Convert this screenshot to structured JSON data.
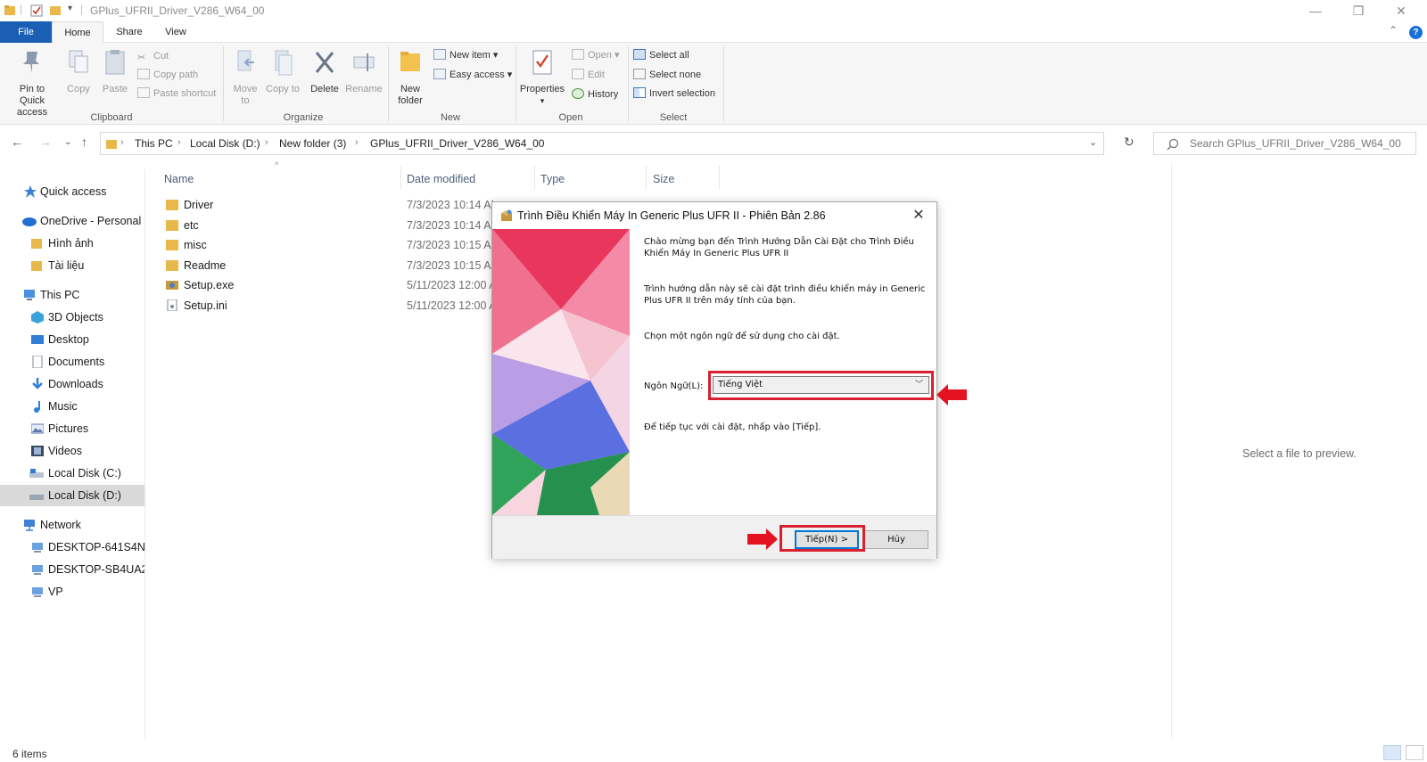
{
  "window": {
    "title": "GPlus_UFRII_Driver_V286_W64_00",
    "controls": {
      "minimize": "—",
      "maximize": "❐",
      "close": "✕"
    }
  },
  "tabs": [
    "File",
    "Home",
    "Share",
    "View"
  ],
  "ribbon": {
    "clipboard": {
      "label": "Clipboard",
      "pin": "Pin to Quick access",
      "copy": "Copy",
      "paste": "Paste",
      "cut": "Cut",
      "copy_path": "Copy path",
      "paste_shortcut": "Paste shortcut"
    },
    "organize": {
      "label": "Organize",
      "move_to": "Move to",
      "copy_to": "Copy to",
      "delete": "Delete",
      "rename": "Rename"
    },
    "new": {
      "label": "New",
      "new_folder": "New folder",
      "new_item": "New item",
      "easy_access": "Easy access"
    },
    "open": {
      "label": "Open",
      "properties": "Properties",
      "open": "Open",
      "edit": "Edit",
      "history": "History"
    },
    "select": {
      "label": "Select",
      "select_all": "Select all",
      "select_none": "Select none",
      "invert_selection": "Invert selection"
    }
  },
  "address": {
    "crumbs": [
      "This PC",
      "Local Disk (D:)",
      "New folder (3)",
      "GPlus_UFRII_Driver_V286_W64_00"
    ],
    "search_placeholder": "Search GPlus_UFRII_Driver_V286_W64_00"
  },
  "sidebar": {
    "items": [
      {
        "label": "Quick access",
        "icon": "star-icon"
      },
      {
        "label": "OneDrive - Personal",
        "icon": "cloud-icon"
      },
      {
        "label": "Hình ảnh",
        "icon": "folder-icon"
      },
      {
        "label": "Tài liệu",
        "icon": "folder-icon"
      },
      {
        "label": "This PC",
        "icon": "computer-icon"
      },
      {
        "label": "3D Objects",
        "icon": "cube-icon"
      },
      {
        "label": "Desktop",
        "icon": "desktop-icon"
      },
      {
        "label": "Documents",
        "icon": "documents-icon"
      },
      {
        "label": "Downloads",
        "icon": "download-icon"
      },
      {
        "label": "Music",
        "icon": "music-icon"
      },
      {
        "label": "Pictures",
        "icon": "pictures-icon"
      },
      {
        "label": "Videos",
        "icon": "videos-icon"
      },
      {
        "label": "Local Disk (C:)",
        "icon": "drive-icon"
      },
      {
        "label": "Local Disk (D:)",
        "icon": "drive-icon"
      },
      {
        "label": "Network",
        "icon": "network-icon"
      },
      {
        "label": "DESKTOP-641S4NE",
        "icon": "computer-icon"
      },
      {
        "label": "DESKTOP-SB4UA2G",
        "icon": "computer-icon"
      },
      {
        "label": "VP",
        "icon": "computer-icon"
      }
    ]
  },
  "filelist": {
    "columns": [
      "Name",
      "Date modified",
      "Type",
      "Size"
    ],
    "rows": [
      {
        "name": "Driver",
        "date": "7/3/2023 10:14 AM",
        "icon": "folder-icon"
      },
      {
        "name": "etc",
        "date": "7/3/2023 10:14 AM",
        "icon": "folder-icon"
      },
      {
        "name": "misc",
        "date": "7/3/2023 10:15 AM",
        "icon": "folder-icon"
      },
      {
        "name": "Readme",
        "date": "7/3/2023 10:15 AM",
        "icon": "folder-icon"
      },
      {
        "name": "Setup.exe",
        "date": "5/11/2023 12:00 AM",
        "icon": "setup-exe-icon"
      },
      {
        "name": "Setup.ini",
        "date": "5/11/2023 12:00 AM",
        "icon": "ini-file-icon"
      }
    ]
  },
  "preview": {
    "text": "Select a file to preview."
  },
  "status": {
    "items": "6 items"
  },
  "dialog": {
    "title": "Trình Điều Khiển Máy In Generic Plus UFR II - Phiên Bản 2.86",
    "welcome": "Chào mừng bạn đến Trình Hướng Dẫn Cài Đặt cho Trình Điều Khiển Máy In Generic Plus UFR II",
    "description": "Trình hướng dẫn này sẽ cài đặt trình điều khiển máy in Generic Plus UFR II trên máy tính của bạn.",
    "choose_language": "Chọn một ngôn ngữ để sử dụng cho cài đặt.",
    "language_label": "Ngôn Ngữ(L):",
    "language_value": "Tiếng Việt",
    "continue_hint": "Để tiếp tục với cài đặt, nhấp vào [Tiếp].",
    "next_button": "Tiếp(N) >",
    "cancel_button": "Hủy"
  },
  "colors": {
    "accent": "#1a5fb4",
    "highlight": "#d8202f",
    "folder": "#e8b84a"
  }
}
